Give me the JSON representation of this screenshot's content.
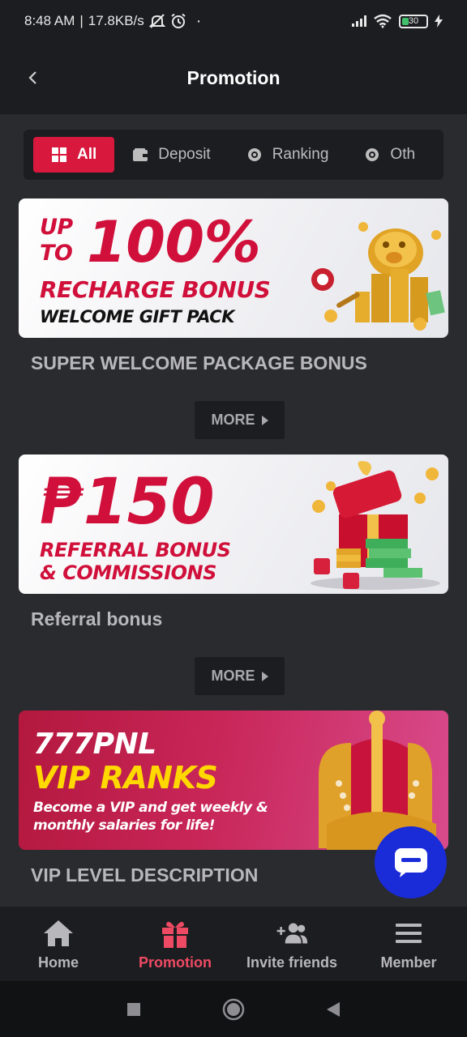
{
  "status_bar": {
    "time": "8:48 AM",
    "speed": "17.8KB/s",
    "battery": "30"
  },
  "header": {
    "title": "Promotion"
  },
  "tabs": [
    {
      "label": "All",
      "icon": "grid-icon",
      "active": true
    },
    {
      "label": "Deposit",
      "icon": "wallet-icon",
      "active": false
    },
    {
      "label": "Ranking",
      "icon": "ranking-icon",
      "active": false
    },
    {
      "label": "Oth",
      "icon": "other-icon",
      "active": false
    }
  ],
  "promos": [
    {
      "banner": {
        "line1": "UP",
        "line2": "TO",
        "big": "100%",
        "line3": "RECHARGE BONUS",
        "line4": "WELCOME GIFT PACK"
      },
      "title": "SUPER WELCOME PACKAGE BONUS",
      "more_label": "MORE"
    },
    {
      "banner": {
        "big": "₱150",
        "line1": "REFERRAL BONUS",
        "line2": "& COMMISSIONS"
      },
      "title": "Referral bonus",
      "more_label": "MORE"
    },
    {
      "banner": {
        "line1": "777PNL",
        "line2": "VIP RANKS",
        "line3": "Become a VIP and get weekly &",
        "line4": "monthly salaries for life!"
      },
      "title": "VIP LEVEL DESCRIPTION"
    }
  ],
  "bottom_nav": [
    {
      "label": "Home",
      "icon": "home-icon",
      "active": false
    },
    {
      "label": "Promotion",
      "icon": "gift-icon",
      "active": true
    },
    {
      "label": "Invite friends",
      "icon": "add-user-icon",
      "active": false
    },
    {
      "label": "Member",
      "icon": "menu-icon",
      "active": false
    }
  ],
  "colors": {
    "accent": "#d8183c",
    "background": "#2a2b2f",
    "panel": "#1c1d21",
    "chat": "#1a2bd8"
  }
}
